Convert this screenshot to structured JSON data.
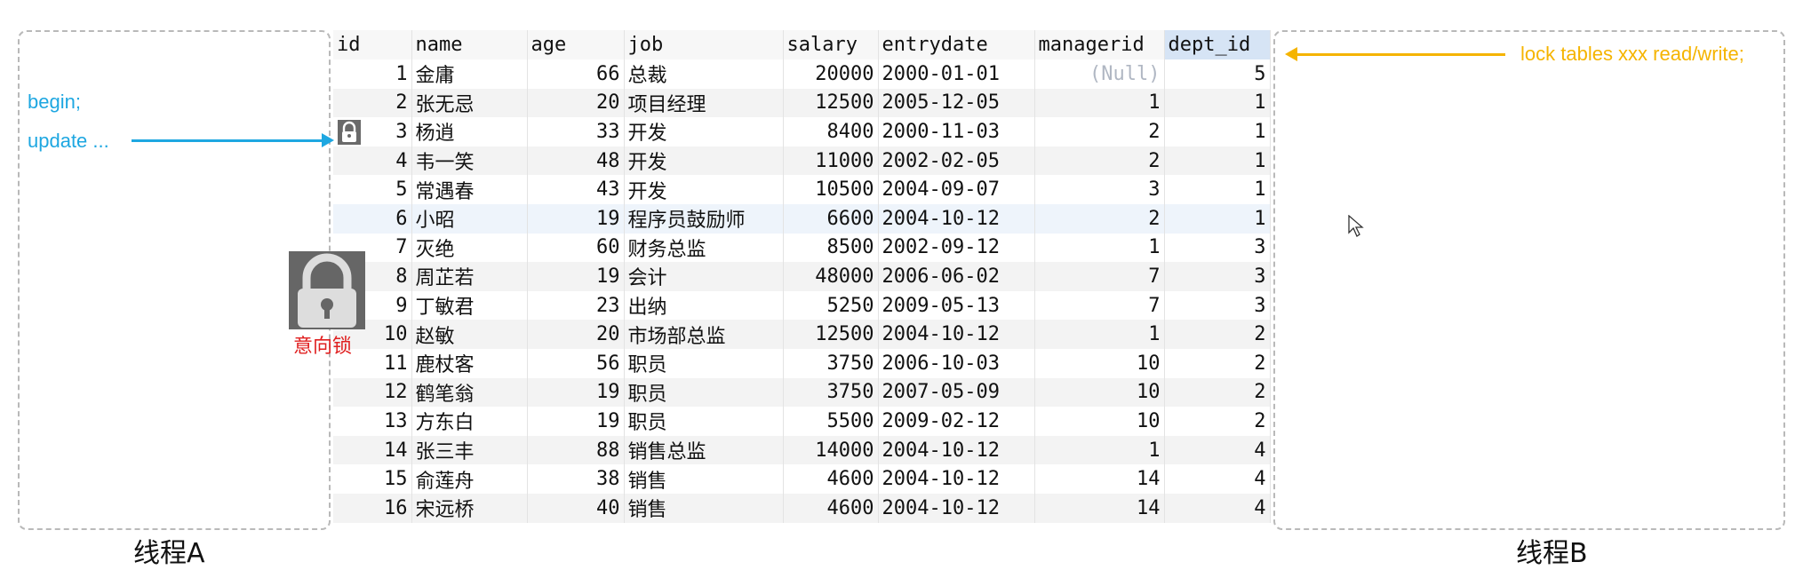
{
  "thread_a": {
    "label": "线程A",
    "begin": "begin;",
    "update": "update ..."
  },
  "thread_b": {
    "label": "线程B",
    "lock_text": "lock tables xxx read/write;"
  },
  "intent_lock_label": "意向锁",
  "table": {
    "columns": [
      "id",
      "name",
      "age",
      "job",
      "salary",
      "entrydate",
      "managerid",
      "dept_id"
    ],
    "rows": [
      [
        "1",
        "金庸",
        "66",
        "总裁",
        "20000",
        "2000-01-01",
        "(Null)",
        "5"
      ],
      [
        "2",
        "张无忌",
        "20",
        "项目经理",
        "12500",
        "2005-12-05",
        "1",
        "1"
      ],
      [
        "3",
        "杨逍",
        "33",
        "开发",
        "8400",
        "2000-11-03",
        "2",
        "1"
      ],
      [
        "4",
        "韦一笑",
        "48",
        "开发",
        "11000",
        "2002-02-05",
        "2",
        "1"
      ],
      [
        "5",
        "常遇春",
        "43",
        "开发",
        "10500",
        "2004-09-07",
        "3",
        "1"
      ],
      [
        "6",
        "小昭",
        "19",
        "程序员鼓励师",
        "6600",
        "2004-10-12",
        "2",
        "1"
      ],
      [
        "7",
        "灭绝",
        "60",
        "财务总监",
        "8500",
        "2002-09-12",
        "1",
        "3"
      ],
      [
        "8",
        "周芷若",
        "19",
        "会计",
        "48000",
        "2006-06-02",
        "7",
        "3"
      ],
      [
        "9",
        "丁敏君",
        "23",
        "出纳",
        "5250",
        "2009-05-13",
        "7",
        "3"
      ],
      [
        "10",
        "赵敏",
        "20",
        "市场部总监",
        "12500",
        "2004-10-12",
        "1",
        "2"
      ],
      [
        "11",
        "鹿杖客",
        "56",
        "职员",
        "3750",
        "2006-10-03",
        "10",
        "2"
      ],
      [
        "12",
        "鹤笔翁",
        "19",
        "职员",
        "3750",
        "2007-05-09",
        "10",
        "2"
      ],
      [
        "13",
        "方东白",
        "19",
        "职员",
        "5500",
        "2009-02-12",
        "10",
        "2"
      ],
      [
        "14",
        "张三丰",
        "88",
        "销售总监",
        "14000",
        "2004-10-12",
        "1",
        "4"
      ],
      [
        "15",
        "俞莲舟",
        "38",
        "销售",
        "4600",
        "2004-10-12",
        "14",
        "4"
      ],
      [
        "16",
        "宋远桥",
        "40",
        "销售",
        "4600",
        "2004-10-12",
        "14",
        "4"
      ]
    ]
  },
  "colors": {
    "blue": "#1ea7e1",
    "orange": "#f5b400",
    "red": "#e02020"
  }
}
